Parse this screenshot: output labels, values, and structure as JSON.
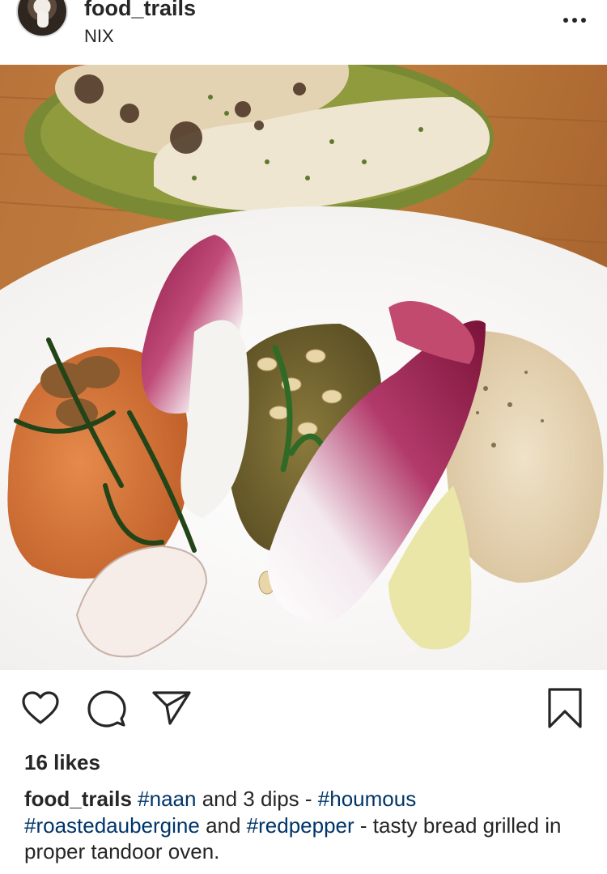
{
  "post": {
    "username": "food_trails",
    "location": "NIX",
    "more_icon": "more-horizontal-icon",
    "likes": "16 likes",
    "caption": {
      "username": "food_trails",
      "tag_naan": "#naan",
      "text_1": " and 3 dips - ",
      "tag_houmous": "#houmous",
      "tag_roastedaubergine": "#roastedaubergine",
      "text_2": " and ",
      "tag_redpepper": "#redpepper",
      "text_3": " - tasty bread grilled in proper tandoor oven."
    }
  },
  "actions": {
    "like_icon": "heart-icon",
    "comment_icon": "comment-icon",
    "share_icon": "send-icon",
    "save_icon": "bookmark-icon"
  },
  "colors": {
    "text": "#262626",
    "hashtag": "#003569",
    "background": "#ffffff"
  }
}
